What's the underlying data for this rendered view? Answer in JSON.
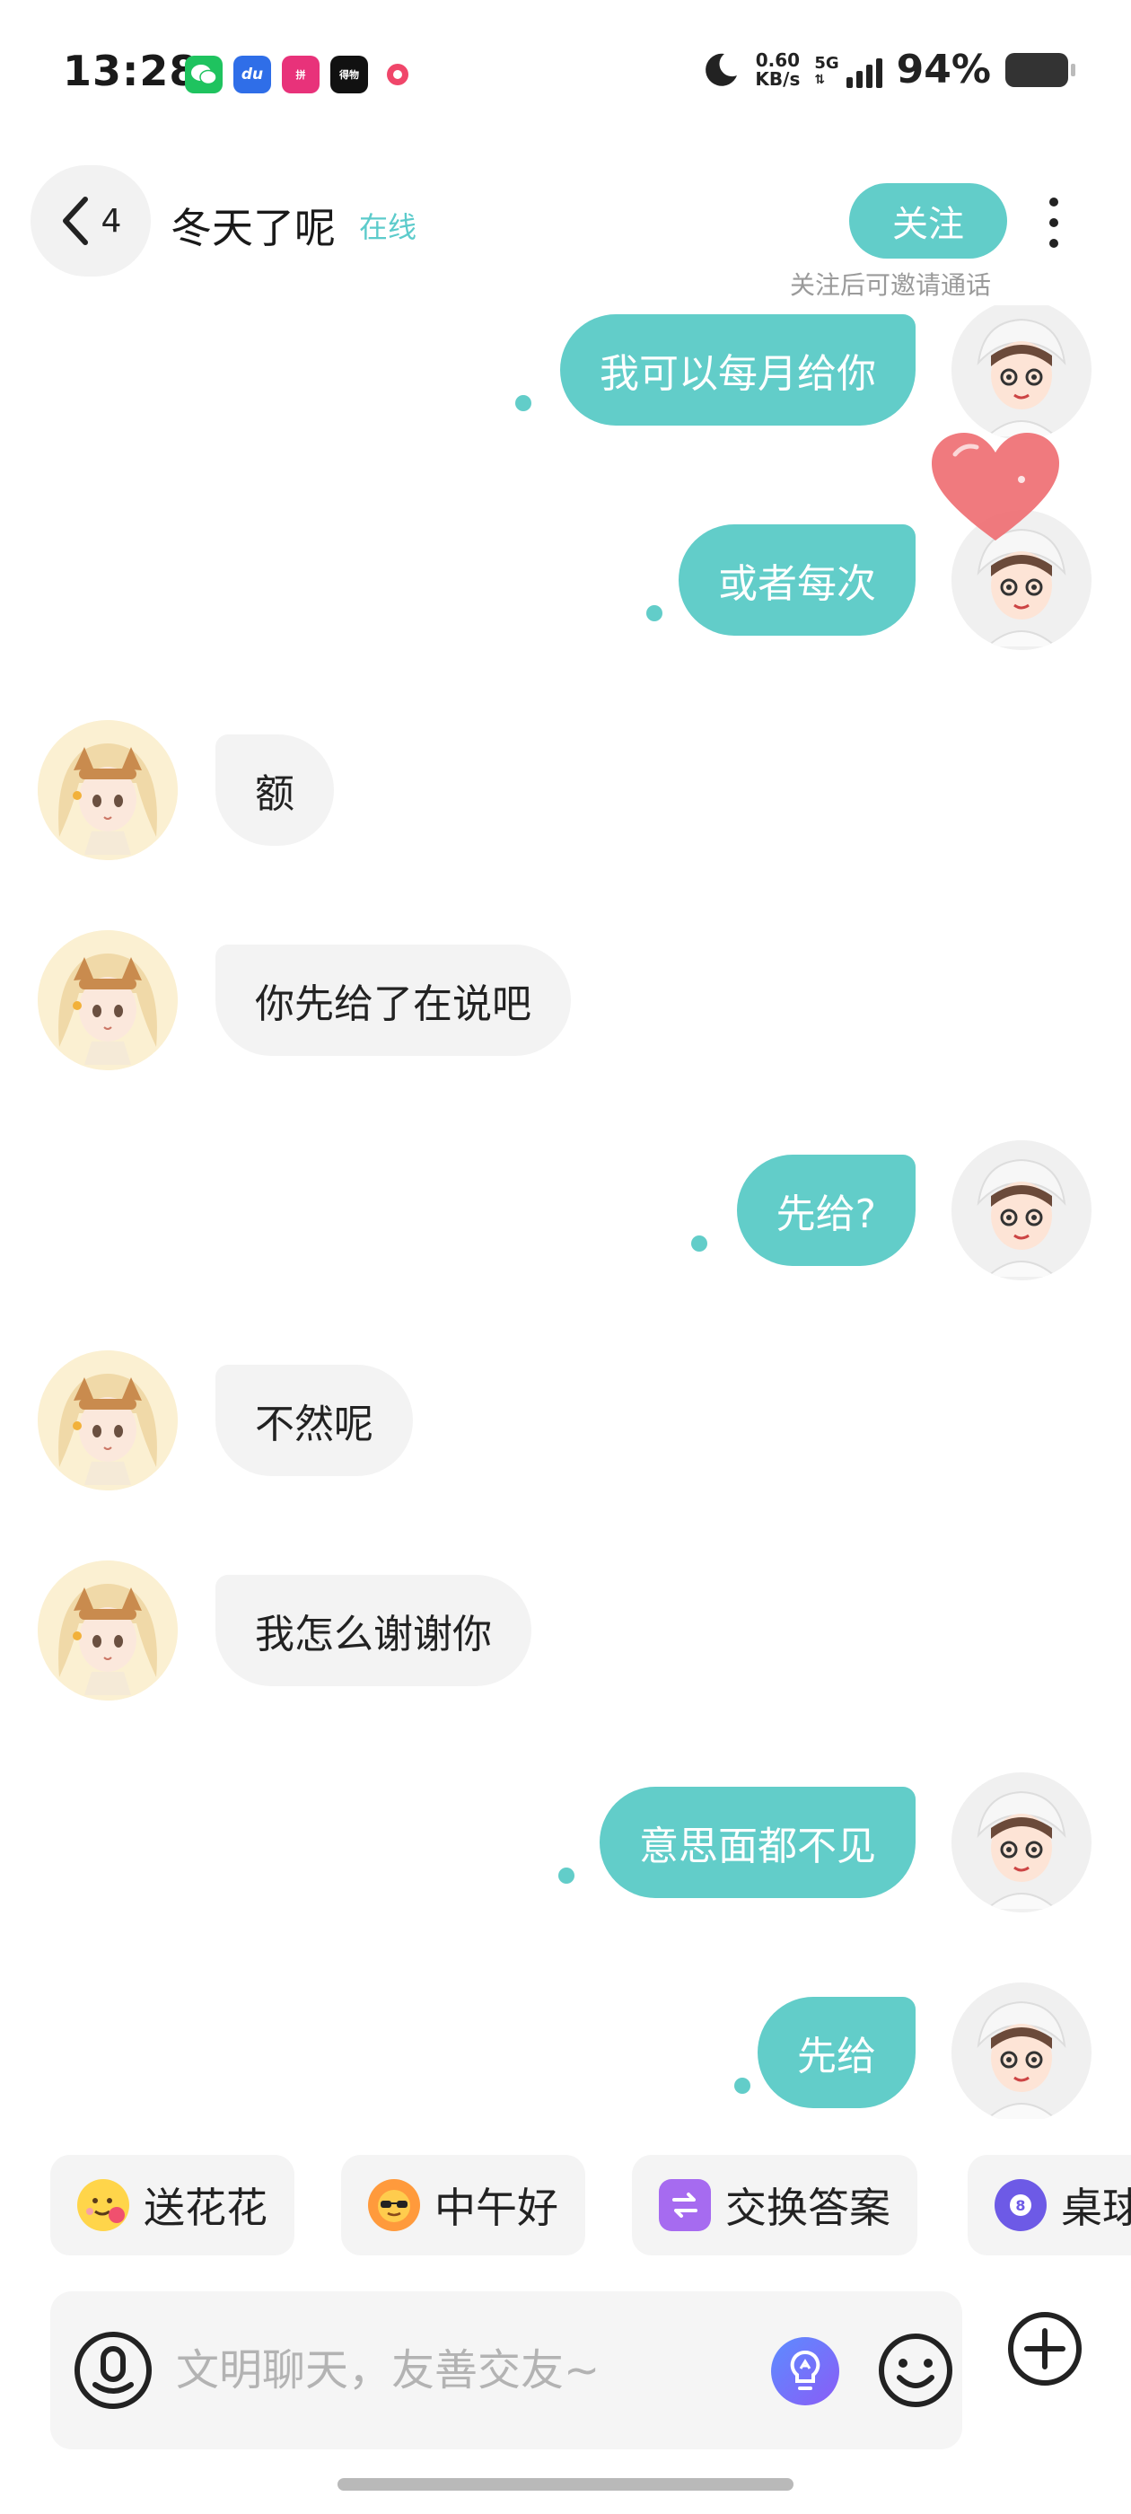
{
  "status_bar": {
    "time": "13:28",
    "net_speed": "0.60",
    "net_unit": "KB/s",
    "network_type": "5G",
    "battery_pct": "94%",
    "app_icons": [
      "wechat-icon",
      "baidu-icon",
      "pinduoduo-icon",
      "douyin-icon",
      "camera-icon"
    ]
  },
  "header": {
    "back_count": "4",
    "name": "冬天了呢",
    "online": "在线",
    "follow_label": "关注",
    "follow_hint": "关注后可邀请通话"
  },
  "messages": [
    {
      "side": "right",
      "text": "我可以每月给你"
    },
    {
      "side": "right",
      "text": "或者每次"
    },
    {
      "side": "left",
      "text": "额"
    },
    {
      "side": "left",
      "text": "你先给了在说吧"
    },
    {
      "side": "right",
      "text": "先给?"
    },
    {
      "side": "left",
      "text": "不然呢"
    },
    {
      "side": "left",
      "text": "我怎么谢谢你"
    },
    {
      "side": "right",
      "text": "意思面都不见"
    },
    {
      "side": "right",
      "text": "先给"
    }
  ],
  "quick_replies": [
    {
      "label": "送花花",
      "icon": "flower-emoji-icon"
    },
    {
      "label": "中午好",
      "icon": "sun-sunglasses-icon"
    },
    {
      "label": "交换答案",
      "icon": "exchange-icon"
    },
    {
      "label": "桌球",
      "icon": "billiard-ball-icon"
    }
  ],
  "input": {
    "placeholder": "文明聊天，友善交友~"
  },
  "colors": {
    "accent": "#62cdc9",
    "incoming_bubble": "#f3f3f3"
  }
}
